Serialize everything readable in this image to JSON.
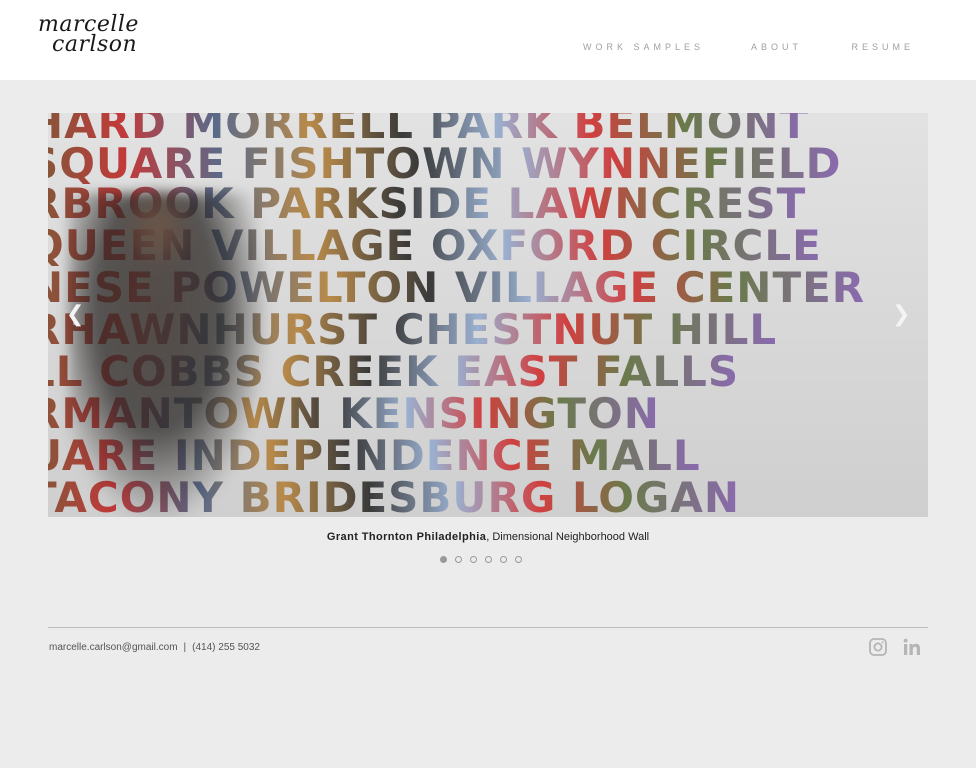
{
  "brand": {
    "line1": "marcelle",
    "line2": "carlson"
  },
  "nav": {
    "items": [
      {
        "label": "WORK SAMPLES"
      },
      {
        "label": "ABOUT"
      },
      {
        "label": "RESUME"
      }
    ]
  },
  "slider": {
    "wall_lines": [
      "HARD MORRELL PARK BELMONT",
      "SQUARE FISHTOWN WYNNEFIELD",
      "RBROOK PARKSIDE LAWNCREST",
      "QUEEN VILLAGE OXFORD CIRCLE",
      "NESE POWELTON VILLAGE CENTER",
      "RHAWNHURST CHESTNUT HILL",
      "LL COBBS CREEK EAST FALLS",
      "RMANTOWN KENSINGTON",
      "UARE INDEPENDENCE MALL",
      "TACONY BRIDESBURG LOGAN"
    ],
    "prev_icon": "chevron-left-icon",
    "next_icon": "chevron-right-icon"
  },
  "caption": {
    "title": "Grant Thornton Philadelphia",
    "subtitle": ", Dimensional Neighborhood Wall"
  },
  "pagination": {
    "count": 6,
    "active": 1
  },
  "footer": {
    "email": "marcelle.carlson@gmail.com",
    "separator": "|",
    "phone": "(414) 255 5032",
    "social": [
      {
        "icon": "instagram-icon"
      },
      {
        "icon": "linkedin-icon"
      }
    ]
  },
  "colors": {
    "background": "#ececec",
    "header": "#ffffff",
    "nav_text": "#a0a0a0"
  }
}
